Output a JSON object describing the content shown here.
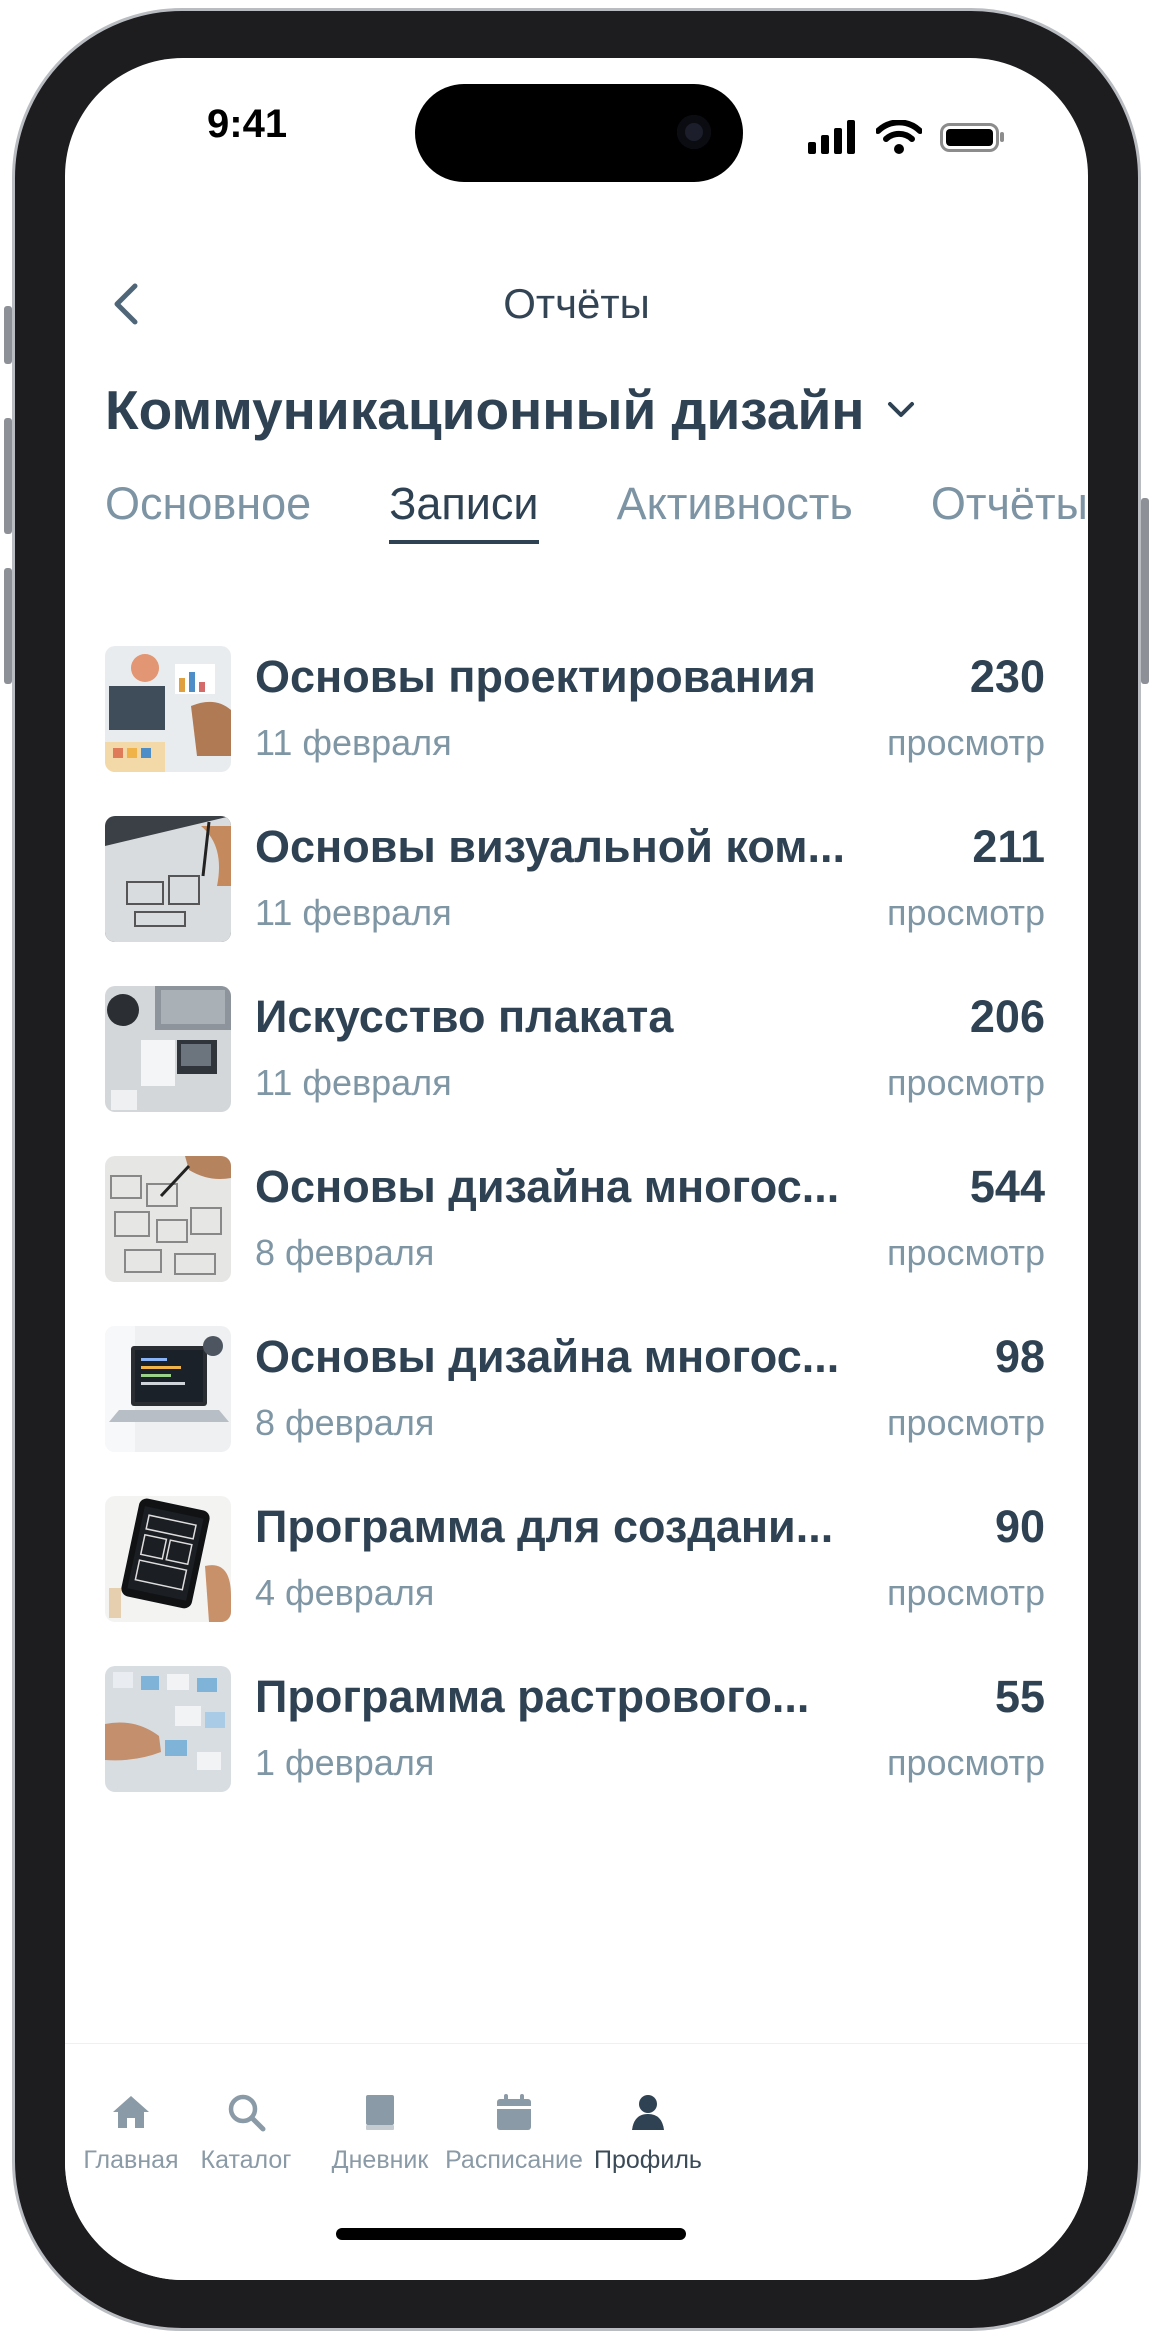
{
  "status_bar": {
    "time": "9:41"
  },
  "header": {
    "title": "Отчёты"
  },
  "course": {
    "name": "Коммуникационный дизайн"
  },
  "tabs": [
    {
      "label": "Основное",
      "active": false
    },
    {
      "label": "Записи",
      "active": true
    },
    {
      "label": "Активность",
      "active": false
    },
    {
      "label": "Отчёты",
      "active": false
    }
  ],
  "items": [
    {
      "title": "Основы проектирования",
      "date": "11 февраля",
      "count": "230",
      "unit": "просмотр",
      "thumb": "designer-charts-photo"
    },
    {
      "title": "Основы визуальной ком...",
      "date": "11 февраля",
      "count": "211",
      "unit": "просмотр",
      "thumb": "wireframe-sketch-photo"
    },
    {
      "title": "Искусство плаката",
      "date": "11 февраля",
      "count": "206",
      "unit": "просмотр",
      "thumb": "desk-poster-photo"
    },
    {
      "title": "Основы дизайна многос...",
      "date": "8 февраля",
      "count": "544",
      "unit": "просмотр",
      "thumb": "paper-sketches-photo"
    },
    {
      "title": "Основы дизайна многос...",
      "date": "8 февраля",
      "count": "98",
      "unit": "просмотр",
      "thumb": "laptop-code-photo"
    },
    {
      "title": "Программа для создани...",
      "date": "4 февраля",
      "count": "90",
      "unit": "просмотр",
      "thumb": "tablet-wireframe-photo"
    },
    {
      "title": "Программа растрового...",
      "date": "1 февраля",
      "count": "55",
      "unit": "просмотр",
      "thumb": "board-sticky-notes-photo"
    }
  ],
  "tabbar": [
    {
      "label": "Главная",
      "icon": "home-icon",
      "active": false
    },
    {
      "label": "Каталог",
      "icon": "search-icon",
      "active": false
    },
    {
      "label": "Дневник",
      "icon": "book-icon",
      "active": false
    },
    {
      "label": "Расписание",
      "icon": "calendar-icon",
      "active": false
    },
    {
      "label": "Профиль",
      "icon": "profile-icon",
      "active": true
    }
  ],
  "colors": {
    "text_primary": "#2e4253",
    "text_secondary": "#7f96a5",
    "tab_inactive": "#7d94a4"
  }
}
